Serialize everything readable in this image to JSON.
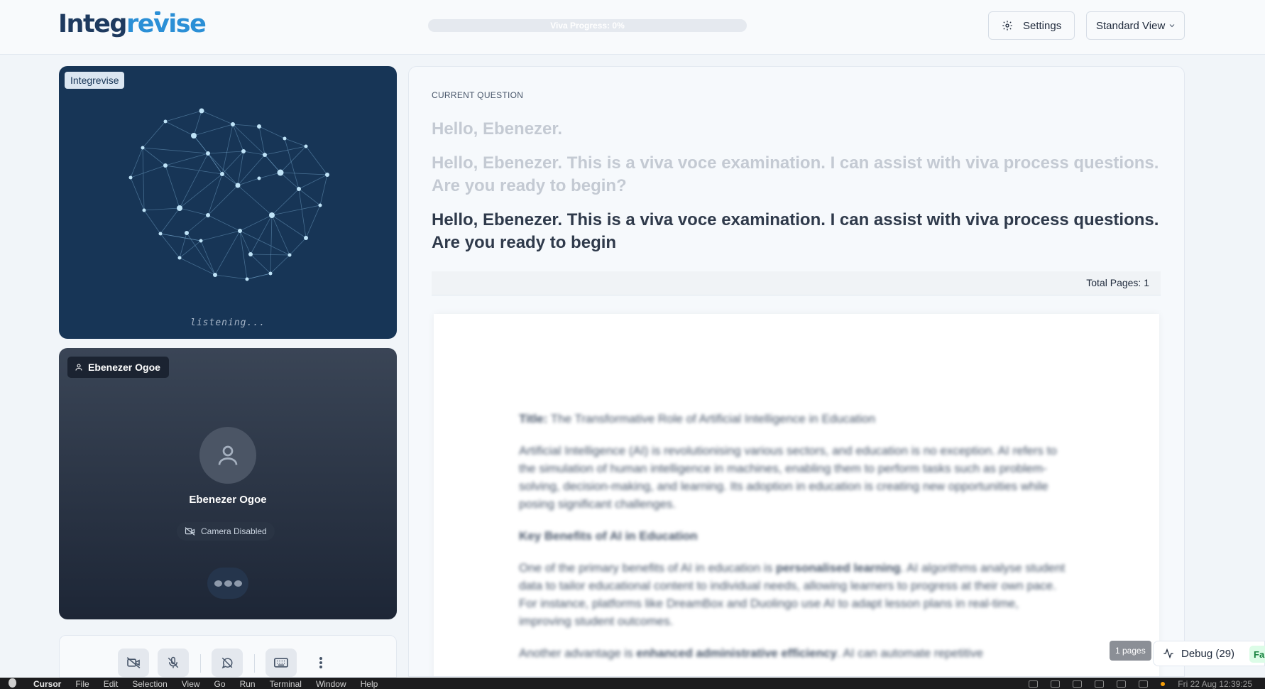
{
  "header": {
    "logo_prefix": "Integ",
    "logo_suffix": "revise",
    "progress_label": "Viva Progress: 0%",
    "progress_percent": 0,
    "settings_label": "Settings",
    "view_label": "Standard View"
  },
  "ai_panel": {
    "label": "Integrevise",
    "status": "listening..."
  },
  "user_panel": {
    "label": "Ebenezer Ogoe",
    "name": "Ebenezer Ogoe",
    "camera_status": "Camera Disabled"
  },
  "question": {
    "heading": "CURRENT QUESTION",
    "lines": [
      "Hello, Ebenezer.",
      "Hello, Ebenezer. This is a viva voce examination. I can assist with viva process questions. Are you ready to begin?",
      "Hello, Ebenezer. This is a viva voce examination. I can assist with viva process questions. Are you ready to begin"
    ]
  },
  "document": {
    "total_pages_label": "Total Pages: 1",
    "title_prefix": "Title:",
    "title": "The Transformative Role of Artificial Intelligence in Education",
    "intro": "Artificial Intelligence (AI) is revolutionising various sectors, and education is no exception. AI refers to the simulation of human intelligence in machines, enabling them to perform tasks such as problem-solving, decision-making, and learning. Its adoption in education is creating new opportunities while posing significant challenges.",
    "section_heading": "Key Benefits of AI in Education",
    "p1_start": "One of the primary benefits of AI in education is ",
    "p1_bold": "personalised learning",
    "p1_end": ". AI algorithms analyse student data to tailor educational content to individual needs, allowing learners to progress at their own pace. For instance, platforms like DreamBox and Duolingo use AI to adapt lesson plans in real-time, improving student outcomes.",
    "p2_start": "Another advantage is ",
    "p2_bold": "enhanced administrative efficiency",
    "p2_end": ". AI can automate repetitive"
  },
  "footer": {
    "pages_pill": "1 pages",
    "debug_label": "Debug (29)",
    "fab_label": "Fa"
  },
  "menubar": {
    "items": [
      "Cursor",
      "File",
      "Edit",
      "Selection",
      "View",
      "Go",
      "Run",
      "Terminal",
      "Window",
      "Help"
    ],
    "clock": "Fri 22 Aug  12:39:25"
  },
  "icons": {
    "settings": "gear-icon",
    "view_toggle": "chevron-down-icon",
    "user_badge": "user-icon",
    "camera_status": "camera-off-icon",
    "controls": [
      "camera-off-icon",
      "mic-off-icon",
      "chat-off-icon",
      "keyboard-icon",
      "more-vertical-icon"
    ],
    "debug": "activity-icon"
  },
  "colors": {
    "brand_dark": "#1e3a5f",
    "brand_light": "#2b8fd6",
    "ai_panel_bg": "#173556"
  }
}
